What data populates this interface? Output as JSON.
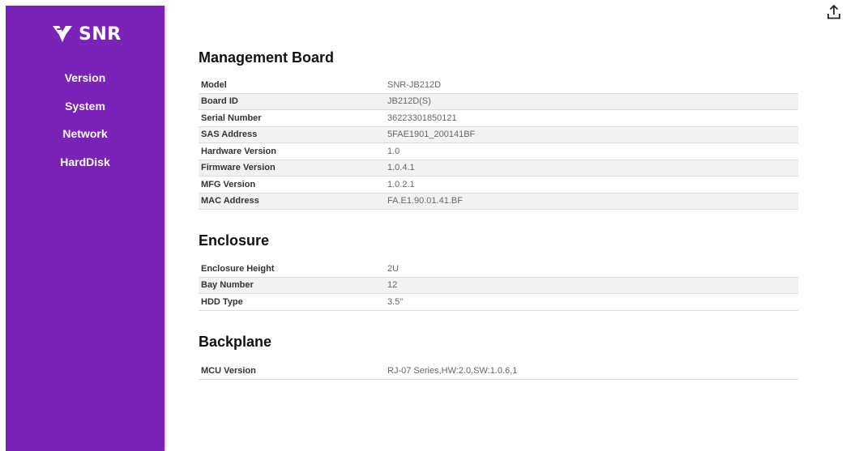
{
  "sidebar": {
    "logo_text": "SNR",
    "items": [
      {
        "label": "Version"
      },
      {
        "label": "System"
      },
      {
        "label": "Network"
      },
      {
        "label": "HardDisk"
      }
    ]
  },
  "toolbar": {
    "export_icon": "upload-export-icon"
  },
  "sections": {
    "management": {
      "title": "Management Board",
      "rows": [
        {
          "key": "Model",
          "value": "SNR-JB212D"
        },
        {
          "key": "Board ID",
          "value": "JB212D(S)"
        },
        {
          "key": "Serial Number",
          "value": "36223301850121"
        },
        {
          "key": "SAS Address",
          "value": "5FAE1901_200141BF"
        },
        {
          "key": "Hardware Version",
          "value": "1.0"
        },
        {
          "key": "Firmware Version",
          "value": "1.0.4.1"
        },
        {
          "key": "MFG Version",
          "value": "1.0.2.1"
        },
        {
          "key": "MAC Address",
          "value": "FA.E1.90.01.41.BF"
        }
      ]
    },
    "enclosure": {
      "title": "Enclosure",
      "rows": [
        {
          "key": "Enclosure Height",
          "value": "2U"
        },
        {
          "key": "Bay Number",
          "value": "12"
        },
        {
          "key": "HDD Type",
          "value": "3.5\""
        }
      ]
    },
    "backplane": {
      "title": "Backplane",
      "rows": [
        {
          "key": "MCU Version",
          "value": "RJ-07 Series,HW:2.0,SW:1.0.6,1"
        }
      ]
    }
  },
  "colors": {
    "sidebar_bg": "#7b22b8",
    "row_alt": "#f2f2f2"
  }
}
